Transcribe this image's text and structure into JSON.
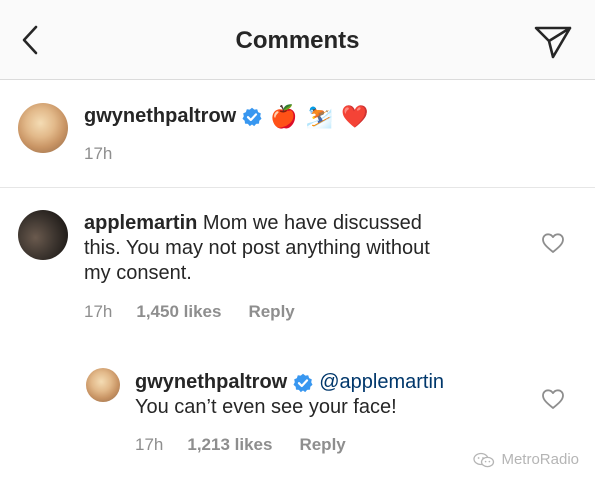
{
  "header": {
    "title": "Comments"
  },
  "caption": {
    "username": "gwynethpaltrow",
    "emojis": [
      "🍎",
      "⛷️",
      "❤️"
    ],
    "time": "17h"
  },
  "comments": [
    {
      "username": "applemartin",
      "text_line1": "Mom we have discussed",
      "text_line2": "this. You may not post anything without",
      "text_line3": "my consent.",
      "time": "17h",
      "likes": "1,450 likes",
      "reply_label": "Reply"
    },
    {
      "username": "gwynethpaltrow",
      "mention": "@applemartin",
      "text": "You can’t even see your face!",
      "time": "17h",
      "likes": "1,213 likes",
      "reply_label": "Reply"
    }
  ],
  "watermark": "MetroRadio",
  "colors": {
    "verified_blue": "#3897f0",
    "mention_blue": "#00376b",
    "meta_gray": "#8e8e8e"
  }
}
